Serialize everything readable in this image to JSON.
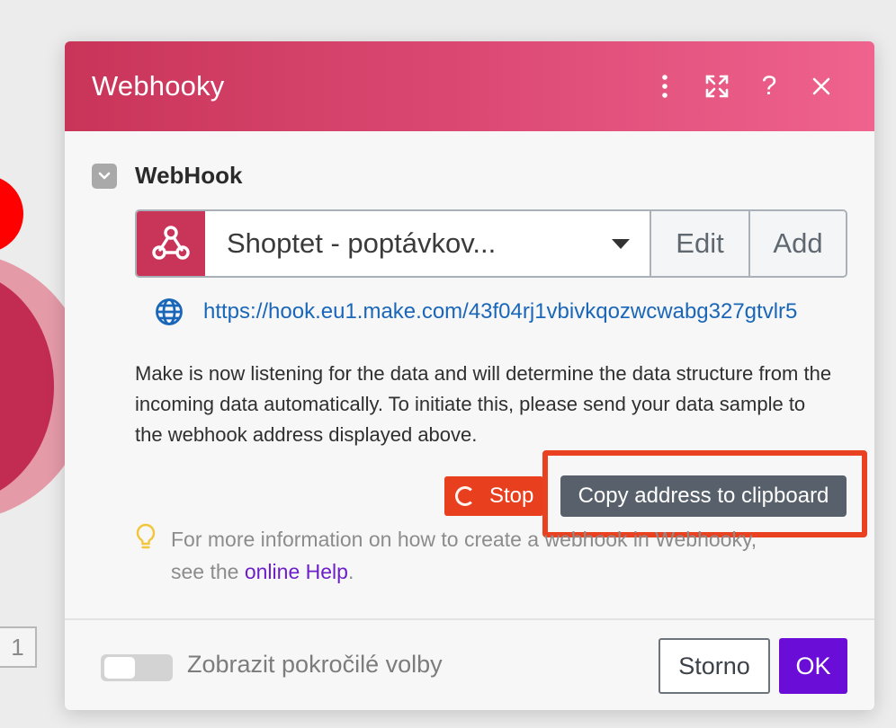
{
  "canvas": {
    "counter": "1"
  },
  "dialog": {
    "title": "Webhooky",
    "header_icons": [
      "more-vertical-icon",
      "expand-icon",
      "help-icon",
      "close-icon"
    ],
    "help_glyph": "?",
    "close_glyph": "×"
  },
  "section": {
    "title": "WebHook",
    "collapsed": false
  },
  "webhook": {
    "selected": "Shoptet - poptávkov...",
    "edit_label": "Edit",
    "add_label": "Add",
    "url": "https://hook.eu1.make.com/43f04rj1vbivkqozwcwabg327gtvlr5"
  },
  "info": {
    "text": "Make is now listening for the data and will determine the data structure from the incoming data automatically. To initiate this, please send your data sample to the webhook address displayed above."
  },
  "actions": {
    "stop_label": "Stop",
    "copy_label": "Copy address to clipboard"
  },
  "help": {
    "prefix": "For more information on how to create a webhook in Webhooky,",
    "see_the": "see the ",
    "link_label": "online Help",
    "suffix": "."
  },
  "footer": {
    "toggle_label": "Zobrazit pokročilé volby",
    "toggle_on": false,
    "cancel_label": "Storno",
    "ok_label": "OK"
  },
  "colors": {
    "header_start": "#c93559",
    "header_end": "#ef638e",
    "stop": "#e8401f",
    "highlight": "#ea4120",
    "copy_btn": "#58616b",
    "link": "#1a66b8",
    "help_link": "#6c1fc8",
    "ok": "#6a0dd6"
  }
}
